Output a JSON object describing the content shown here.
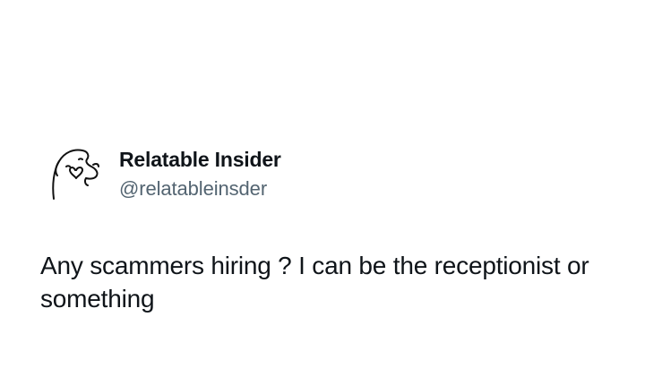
{
  "tweet": {
    "author": {
      "display_name": "Relatable Insider",
      "handle": "@relatableinsder",
      "avatar_icon": "line-drawing-avatar-icon"
    },
    "text": "Any scammers hiring ? I can be the receptionist or something"
  },
  "colors": {
    "background": "#ffffff",
    "name": "#0f1419",
    "handle": "#536471",
    "text": "#0f1419"
  }
}
